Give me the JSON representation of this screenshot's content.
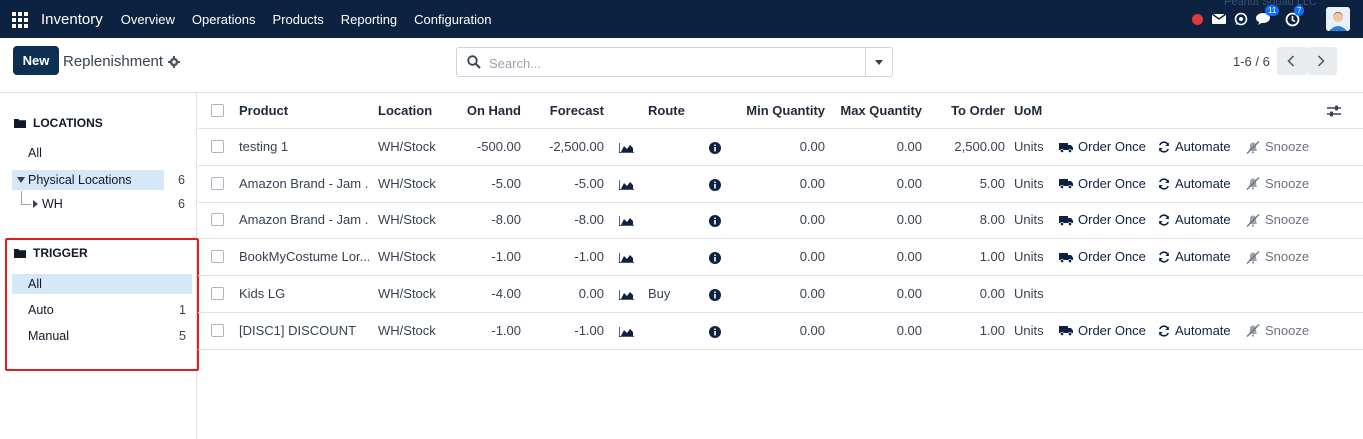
{
  "navbar": {
    "brand": "Inventory",
    "menu": [
      "Overview",
      "Operations",
      "Products",
      "Reporting",
      "Configuration"
    ],
    "company": "Peanut Squad LLC",
    "chat_badge": "11",
    "activity_badge": "7"
  },
  "control": {
    "new_label": "New",
    "title": "Replenishment",
    "search_placeholder": "Search...",
    "pager": "1-6 / 6"
  },
  "sidepanel": {
    "locations_title": "LOCATIONS",
    "locations_all": "All",
    "physical_label": "Physical Locations",
    "physical_count": "6",
    "wh_label": "WH",
    "wh_count": "6",
    "trigger_title": "TRIGGER",
    "trigger_all": "All",
    "auto_label": "Auto",
    "auto_count": "1",
    "manual_label": "Manual",
    "manual_count": "5"
  },
  "table": {
    "headers": {
      "product": "Product",
      "location": "Location",
      "on_hand": "On Hand",
      "forecast": "Forecast",
      "route": "Route",
      "min_qty": "Min Quantity",
      "max_qty": "Max Quantity",
      "to_order": "To Order",
      "uom": "UoM"
    },
    "actions": {
      "order_once": "Order Once",
      "automate": "Automate",
      "snooze": "Snooze"
    },
    "rows": [
      {
        "product": "testing 1",
        "location": "WH/Stock",
        "on_hand": "-500.00",
        "forecast": "-2,500.00",
        "route": "",
        "min_qty": "0.00",
        "max_qty": "0.00",
        "to_order": "2,500.00",
        "uom": "Units",
        "has_actions": true
      },
      {
        "product": "Amazon Brand - Jam ...",
        "location": "WH/Stock",
        "on_hand": "-5.00",
        "forecast": "-5.00",
        "route": "",
        "min_qty": "0.00",
        "max_qty": "0.00",
        "to_order": "5.00",
        "uom": "Units",
        "has_actions": true
      },
      {
        "product": "Amazon Brand - Jam ...",
        "location": "WH/Stock",
        "on_hand": "-8.00",
        "forecast": "-8.00",
        "route": "",
        "min_qty": "0.00",
        "max_qty": "0.00",
        "to_order": "8.00",
        "uom": "Units",
        "has_actions": true
      },
      {
        "product": "BookMyCostume Lor...",
        "location": "WH/Stock",
        "on_hand": "-1.00",
        "forecast": "-1.00",
        "route": "",
        "min_qty": "0.00",
        "max_qty": "0.00",
        "to_order": "1.00",
        "uom": "Units",
        "has_actions": true
      },
      {
        "product": "Kids LG",
        "location": "WH/Stock",
        "on_hand": "-4.00",
        "forecast": "0.00",
        "route": "Buy",
        "min_qty": "0.00",
        "max_qty": "0.00",
        "to_order": "0.00",
        "uom": "Units",
        "has_actions": false
      },
      {
        "product": "[DISC1] DISCOUNT",
        "location": "WH/Stock",
        "on_hand": "-1.00",
        "forecast": "-1.00",
        "route": "",
        "min_qty": "0.00",
        "max_qty": "0.00",
        "to_order": "1.00",
        "uom": "Units",
        "has_actions": true
      }
    ]
  },
  "colors": {
    "navbar": "#0d2240",
    "primary_button": "#0d2f54",
    "highlight_box": "#e11d1d",
    "active_item": "#d6e8f7"
  }
}
